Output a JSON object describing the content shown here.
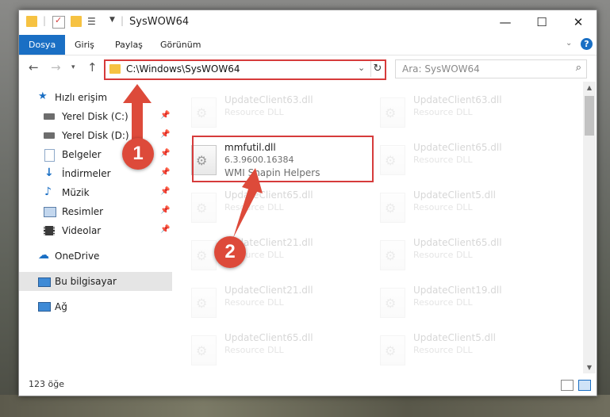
{
  "window": {
    "title": "SysWOW64",
    "minimize": "—",
    "maximize": "☐",
    "close": "✕"
  },
  "ribbon": {
    "tabs": [
      "Dosya",
      "Giriş",
      "Paylaş",
      "Görünüm"
    ],
    "collapse_icon": "chevron-down-icon",
    "help": "?"
  },
  "address": {
    "path": "C:\\Windows\\SysWOW64",
    "search_placeholder": "Ara: SysWOW64"
  },
  "nav": {
    "quick_access": "Hızlı erişim",
    "items": [
      {
        "label": "Yerel Disk (C:)",
        "icon": "drive-icon"
      },
      {
        "label": "Yerel Disk (D:)",
        "icon": "drive-icon"
      },
      {
        "label": "Belgeler",
        "icon": "documents-icon"
      },
      {
        "label": "İndirmeler",
        "icon": "downloads-icon"
      },
      {
        "label": "Müzik",
        "icon": "music-icon"
      },
      {
        "label": "Resimler",
        "icon": "pictures-icon"
      },
      {
        "label": "Videolar",
        "icon": "videos-icon"
      }
    ],
    "onedrive": "OneDrive",
    "this_pc": "Bu bilgisayar",
    "network": "Ağ"
  },
  "files": {
    "highlighted": {
      "name": "mmfutil.dll",
      "version": "6.3.9600.16384",
      "description": "WMI Snapin Helpers"
    },
    "faded": [
      {
        "name": "UpdateClient63.dll",
        "description": "Resource DLL"
      },
      {
        "name": "UpdateClient63.dll",
        "description": "Resource DLL"
      },
      {
        "name": "UpdateClient65.dll",
        "description": "Resource DLL"
      },
      {
        "name": "UpdateClient65.dll",
        "description": "Resource DLL"
      },
      {
        "name": "UpdateClient5.dll",
        "description": "Resource DLL"
      },
      {
        "name": "UpdateClient21.dll",
        "description": "Resource DLL"
      },
      {
        "name": "UpdateClient65.dll",
        "description": "Resource DLL"
      },
      {
        "name": "UpdateClient21.dll",
        "description": "Resource DLL"
      },
      {
        "name": "UpdateClient19.dll",
        "description": "Resource DLL"
      },
      {
        "name": "UpdateClient65.dll",
        "description": "Resource DLL"
      },
      {
        "name": "UpdateClient5.dll",
        "description": "Resource DLL"
      }
    ]
  },
  "status": {
    "count": "123 öğe"
  },
  "callouts": {
    "one": "1",
    "two": "2"
  },
  "colors": {
    "accent": "#1a6fc4",
    "highlight": "#d63b3b",
    "callout": "#dd4a3a"
  }
}
